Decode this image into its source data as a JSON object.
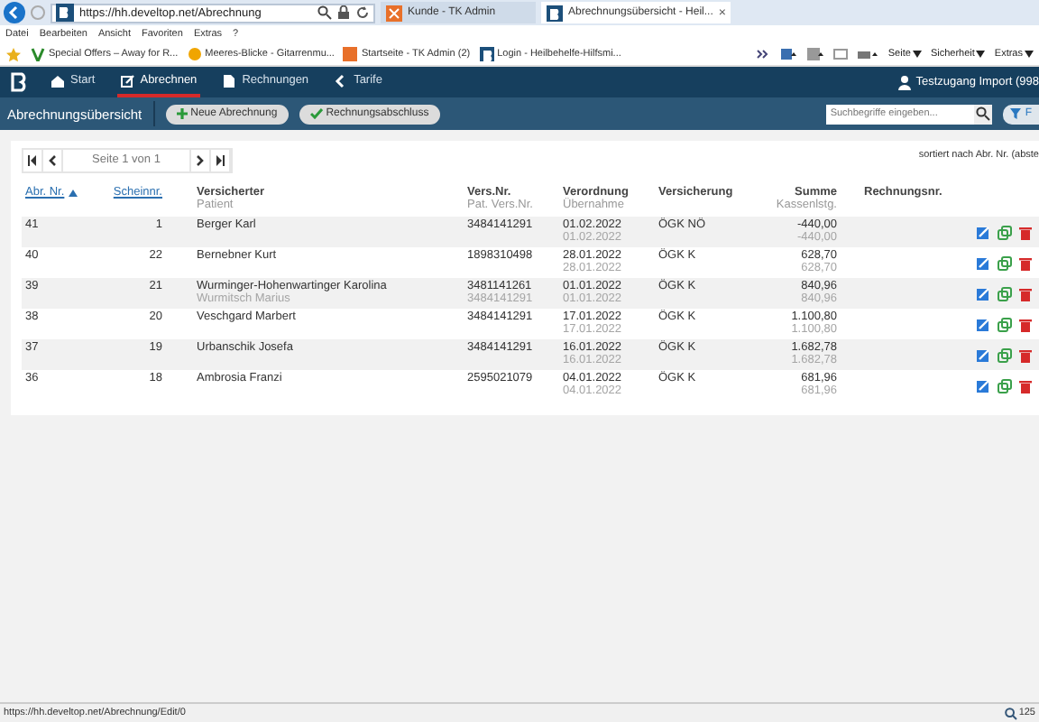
{
  "browser": {
    "address": "https://hh.develtop.net/Abrechnung",
    "tabs": [
      {
        "title": "Kunde - TK Admin",
        "selected": false
      },
      {
        "title": "Abrechnungsübersicht - Heil...",
        "selected": true,
        "close": "×"
      }
    ],
    "menu": [
      "Datei",
      "Bearbeiten",
      "Ansicht",
      "Favoriten",
      "Extras",
      "?"
    ],
    "favorites": [
      "Special Offers – Away for R...",
      "Meeres-Blicke - Gitarrenmu...",
      "Startseite - TK Admin (2)",
      "Login - Heilbehelfe-Hilfsmi..."
    ],
    "commands": [
      "Seite",
      "Sicherheit",
      "Extras"
    ]
  },
  "app_nav": {
    "items": [
      {
        "label": "Start",
        "selected": false
      },
      {
        "label": "Abrechnen",
        "selected": true
      },
      {
        "label": "Rechnungen",
        "selected": false
      },
      {
        "label": "Tarife",
        "selected": false
      }
    ],
    "user": "Testzugang Import (998"
  },
  "toolbar": {
    "title": "Abrechnungsübersicht",
    "buttons": [
      {
        "label": "Neue Abrechnung"
      },
      {
        "label": "Rechnungsabschluss"
      }
    ],
    "search_placeholder": "Suchbegriffe eingeben...",
    "filter_label": "F"
  },
  "pager": {
    "text": "Seite 1 von 1",
    "sort_note": "sortiert nach Abr. Nr. (abste"
  },
  "table": {
    "columns": [
      {
        "label": "Abr. Nr.",
        "kind": "link",
        "sorted": true
      },
      {
        "label": "Scheinnr.",
        "kind": "link",
        "sorted": false
      },
      {
        "label": "Versicherter",
        "sub": "Patient",
        "kind": "plain"
      },
      {
        "label": "Vers.Nr.",
        "sub": "Pat. Vers.Nr.",
        "kind": "plain"
      },
      {
        "label": "Verordnung",
        "sub": "Übernahme",
        "kind": "plain"
      },
      {
        "label": "Versicherung",
        "kind": "plain"
      },
      {
        "label": "Summe",
        "sub": "Kassenlstg.",
        "kind": "plain"
      },
      {
        "label": "Rechnungsnr.",
        "kind": "plain"
      }
    ],
    "rows": [
      {
        "abr_nr": "41",
        "schein_nr": "1",
        "versicherter": "Berger Karl",
        "vers_nr": "3484141291",
        "verordnung": "01.02.2022",
        "uebernahme": "01.02.2022",
        "versicherung": "ÖGK NÖ",
        "summe": "-440,00",
        "kassenleistung": "-440,00"
      },
      {
        "abr_nr": "40",
        "schein_nr": "22",
        "versicherter": "Bernebner Kurt",
        "vers_nr": "1898310498",
        "verordnung": "28.01.2022",
        "uebernahme": "28.01.2022",
        "versicherung": "ÖGK K",
        "summe": "628,70",
        "kassenleistung": "628,70"
      },
      {
        "abr_nr": "39",
        "schein_nr": "21",
        "versicherter": "Wurminger-Hohenwartinger Karolina",
        "patient": "Wurmitsch Marius",
        "vers_nr": "3481141261",
        "pat_vers_nr": "3484141291",
        "verordnung": "01.01.2022",
        "uebernahme": "01.01.2022",
        "versicherung": "ÖGK K",
        "summe": "840,96",
        "kassenleistung": "840,96"
      },
      {
        "abr_nr": "38",
        "schein_nr": "20",
        "versicherter": "Veschgard Marbert",
        "vers_nr": "3484141291",
        "verordnung": "17.01.2022",
        "uebernahme": "17.01.2022",
        "versicherung": "ÖGK K",
        "summe": "1.100,80",
        "kassenleistung": "1.100,80"
      },
      {
        "abr_nr": "37",
        "schein_nr": "19",
        "versicherter": "Urbanschik Josefa",
        "vers_nr": "3484141291",
        "verordnung": "16.01.2022",
        "uebernahme": "16.01.2022",
        "versicherung": "ÖGK K",
        "summe": "1.682,78",
        "kassenleistung": "1.682,78"
      },
      {
        "abr_nr": "36",
        "schein_nr": "18",
        "versicherter": "Ambrosia Franzi",
        "vers_nr": "2595021079",
        "verordnung": "04.01.2022",
        "uebernahme": "04.01.2022",
        "versicherung": "ÖGK K",
        "summe": "681,96",
        "kassenleistung": "681,96"
      }
    ]
  },
  "status_bar": {
    "url": "https://hh.develtop.net/Abrechnung/Edit/0",
    "zoom": "125"
  }
}
